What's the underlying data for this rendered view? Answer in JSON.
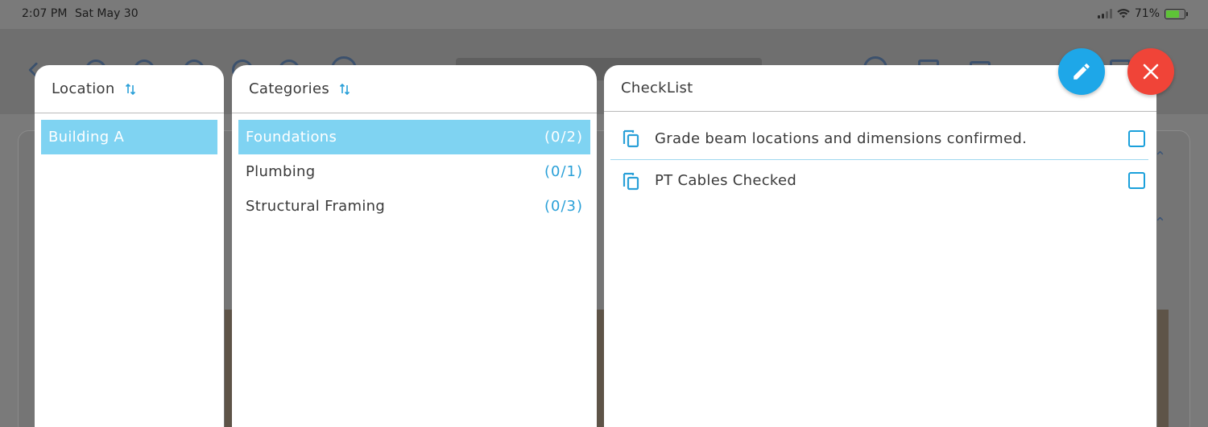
{
  "status_bar": {
    "time": "2:07 PM",
    "date": "Sat May 30",
    "battery_percent": "71%",
    "battery_level": 0.71
  },
  "location_panel": {
    "title": "Location",
    "items": [
      {
        "label": "Building A",
        "selected": true
      }
    ]
  },
  "categories_panel": {
    "title": "Categories",
    "items": [
      {
        "label": "Foundations",
        "count": "(0/2)",
        "selected": true
      },
      {
        "label": "Plumbing",
        "count": "(0/1)",
        "selected": false
      },
      {
        "label": "Structural Framing",
        "count": "(0/3)",
        "selected": false
      }
    ]
  },
  "checklist_panel": {
    "title": "CheckList",
    "items": [
      {
        "label": "Grade beam locations and dimensions confirmed.",
        "checked": false
      },
      {
        "label": "PT Cables Checked",
        "checked": false
      }
    ]
  },
  "buttons": {
    "edit_icon": "pencil-icon",
    "close_icon": "close-icon"
  },
  "colors": {
    "accent_blue": "#1ea7e8",
    "selected_row": "#7fd3f2",
    "close_red": "#f04438"
  }
}
